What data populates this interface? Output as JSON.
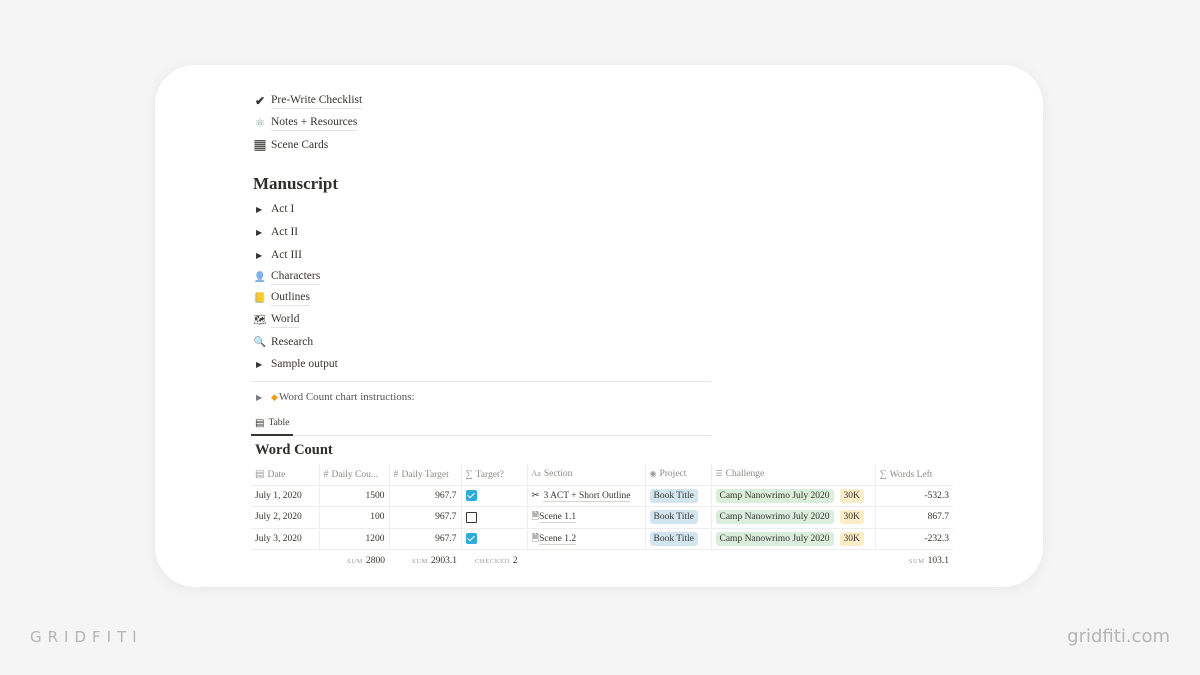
{
  "links": [
    {
      "icon": "checkmark-icon",
      "glyph": "✔",
      "label": "Pre-Write Checklist"
    },
    {
      "icon": "atom-icon",
      "glyph": "⚛",
      "label": "Notes + Resources"
    },
    {
      "icon": "grid-icon",
      "glyph": "▦",
      "label": "Scene Cards"
    }
  ],
  "manuscript": {
    "heading": "Manuscript",
    "toggles": [
      {
        "label": "Act I"
      },
      {
        "label": "Act II"
      },
      {
        "label": "Act III"
      }
    ],
    "pages": [
      {
        "icon": "bust-icon",
        "glyph": "👤",
        "label": "Characters"
      },
      {
        "icon": "ledger-icon",
        "glyph": "📒",
        "label": "Outlines"
      },
      {
        "icon": "map-icon",
        "glyph": "🗺",
        "label": "World"
      },
      {
        "icon": "magnifier-icon",
        "glyph": "🔍",
        "label": "Research"
      }
    ],
    "sample_toggle": "Sample output"
  },
  "instructions_toggle": "Word Count chart instructions:",
  "view_tab": "Table",
  "database": {
    "title": "Word Count",
    "columns": [
      {
        "icon": "calendar-icon",
        "glyph": "▤",
        "label": "Date"
      },
      {
        "icon": "number-icon",
        "glyph": "#",
        "label": "Daily Cou..."
      },
      {
        "icon": "number-icon",
        "glyph": "#",
        "label": "Daily Target"
      },
      {
        "icon": "sigma-icon",
        "glyph": "∑",
        "label": "Target?"
      },
      {
        "icon": "text-icon",
        "glyph": "Aa",
        "label": "Section"
      },
      {
        "icon": "relation-icon",
        "glyph": "◉",
        "label": "Project"
      },
      {
        "icon": "list-icon",
        "glyph": "☰",
        "label": "Challenge"
      },
      {
        "icon": "sigma-icon",
        "glyph": "∑",
        "label": "Words Left"
      }
    ],
    "rows": [
      {
        "date": "July 1, 2020",
        "daily_count": "1500",
        "daily_target": "967.7",
        "target_met": true,
        "section_icon": "✂",
        "section": "3 ACT + Short Outline",
        "project": "Book Title",
        "challenge": "Camp Nanowrimo July 2020",
        "challenge_tag": "30K",
        "words_left": "-532.3"
      },
      {
        "date": "July 2, 2020",
        "daily_count": "100",
        "daily_target": "967.7",
        "target_met": false,
        "section_icon": "🗎",
        "section": "Scene 1.1",
        "project": "Book Title",
        "challenge": "Camp Nanowrimo July 2020",
        "challenge_tag": "30K",
        "words_left": "867.7"
      },
      {
        "date": "July 3, 2020",
        "daily_count": "1200",
        "daily_target": "967.7",
        "target_met": true,
        "section_icon": "🗎",
        "section": "Scene 1.2",
        "project": "Book Title",
        "challenge": "Camp Nanowrimo July 2020",
        "challenge_tag": "30K",
        "words_left": "-232.3"
      }
    ],
    "footer": {
      "daily_count": {
        "label": "SUM",
        "value": "2800"
      },
      "daily_target": {
        "label": "SUM",
        "value": "2903.1"
      },
      "target": {
        "label": "CHECKED",
        "value": "2"
      },
      "words_left": {
        "label": "SUM",
        "value": "103.1"
      }
    }
  },
  "branding": {
    "left": "GRIDFITI",
    "right": "gridfiti.com"
  }
}
